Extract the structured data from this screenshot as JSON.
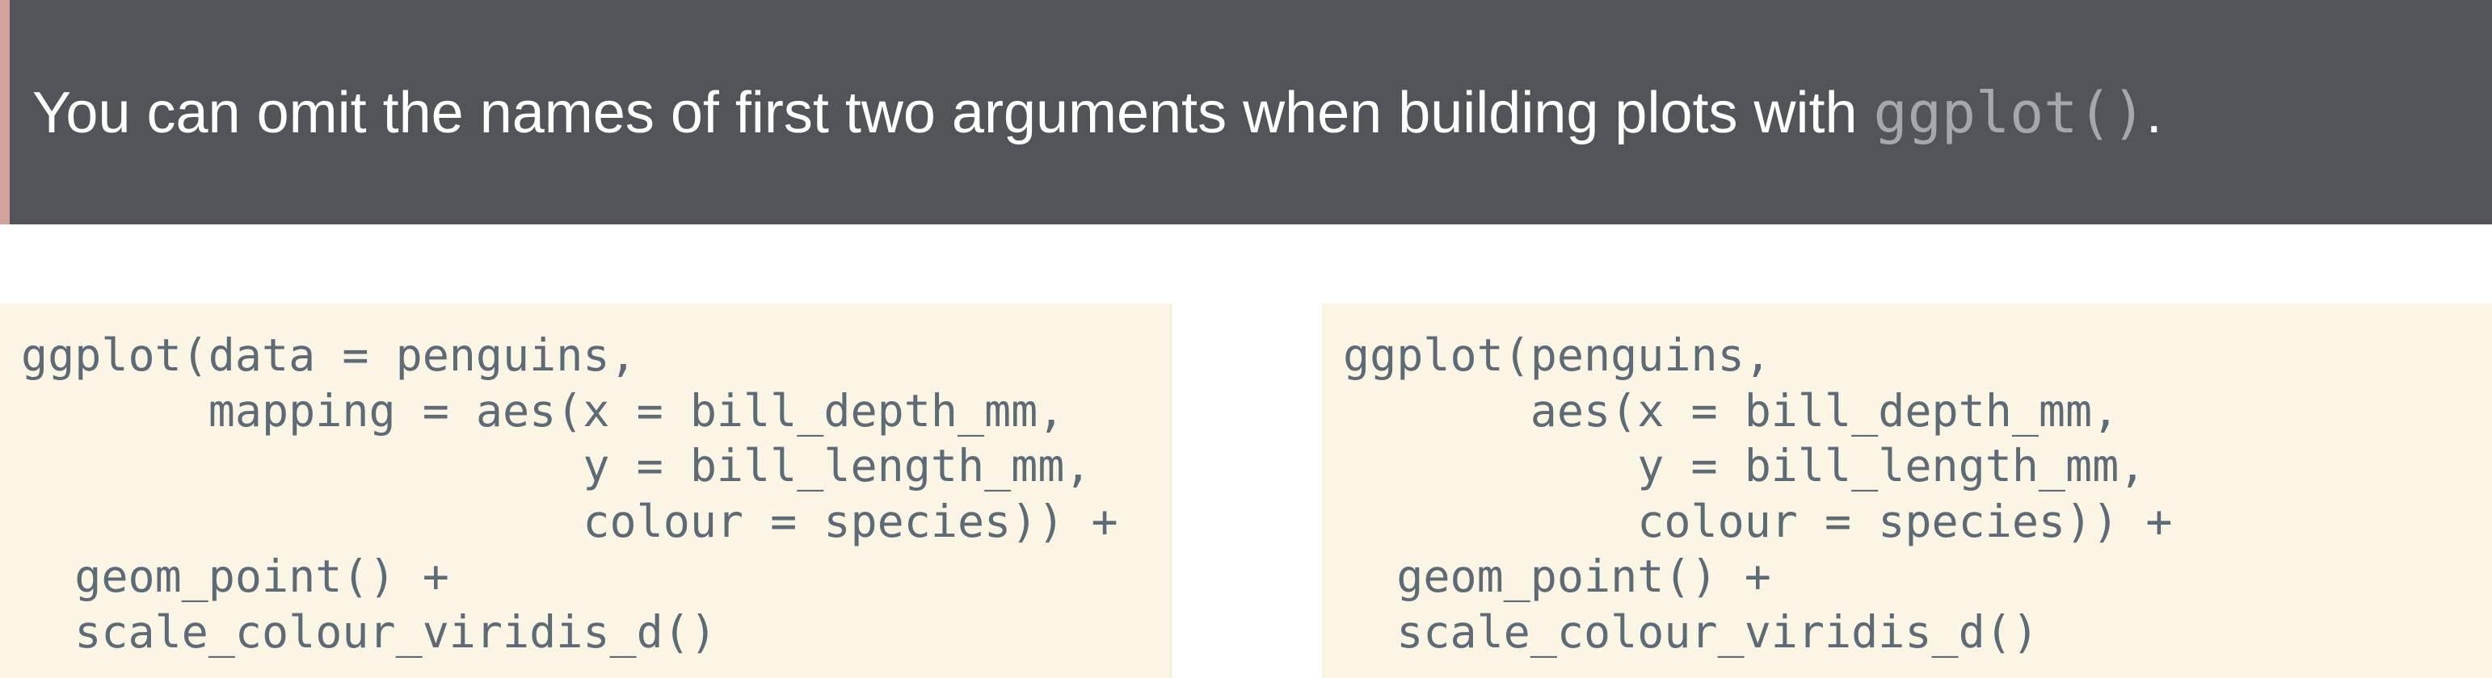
{
  "banner": {
    "text_before": "You can omit the names of first two arguments when building plots with ",
    "code": "ggplot()",
    "text_after": "."
  },
  "code_left": {
    "lines": [
      "ggplot(data = penguins,",
      "       mapping = aes(x = bill_depth_mm,",
      "                     y = bill_length_mm,",
      "                     colour = species)) +",
      "  geom_point() +",
      "  scale_colour_viridis_d()"
    ]
  },
  "code_right": {
    "lines": [
      "ggplot(penguins,",
      "       aes(x = bill_depth_mm,",
      "           y = bill_length_mm,",
      "           colour = species)) +",
      "  geom_point() +",
      "  scale_colour_viridis_d()"
    ]
  }
}
